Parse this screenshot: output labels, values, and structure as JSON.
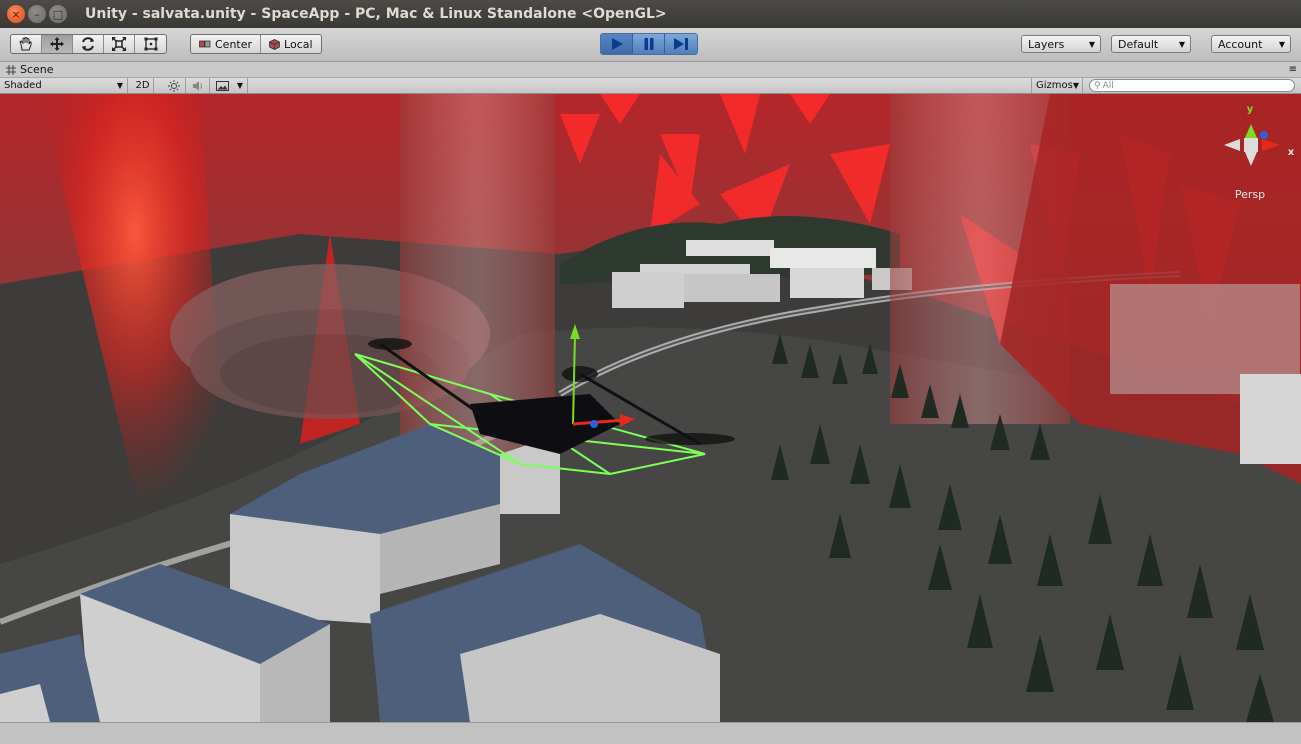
{
  "window": {
    "title": "Unity - salvata.unity - SpaceApp - PC, Mac & Linux Standalone <OpenGL>",
    "close_glyph": "×",
    "minimize_glyph": "–",
    "maximize_glyph": "□"
  },
  "toolbar": {
    "tools": [
      {
        "name": "hand-icon"
      },
      {
        "name": "move-icon"
      },
      {
        "name": "rotate-icon"
      },
      {
        "name": "scale-icon"
      },
      {
        "name": "rect-icon"
      }
    ],
    "pivot_center": "Center",
    "pivot_local": "Local",
    "layers": "Layers",
    "layout": "Default",
    "account": "Account"
  },
  "scene": {
    "tab_label": "Scene",
    "draw_mode": "Shaded",
    "mode_2d": "2D",
    "gizmos": "Gizmos",
    "search_placeholder": "All",
    "axis_y": "y",
    "axis_x": "x",
    "projection": "Persp"
  },
  "colors": {
    "accent": "#4f7fbe",
    "red_barrier": "#c41414",
    "selection_wire": "#7cff5a"
  }
}
